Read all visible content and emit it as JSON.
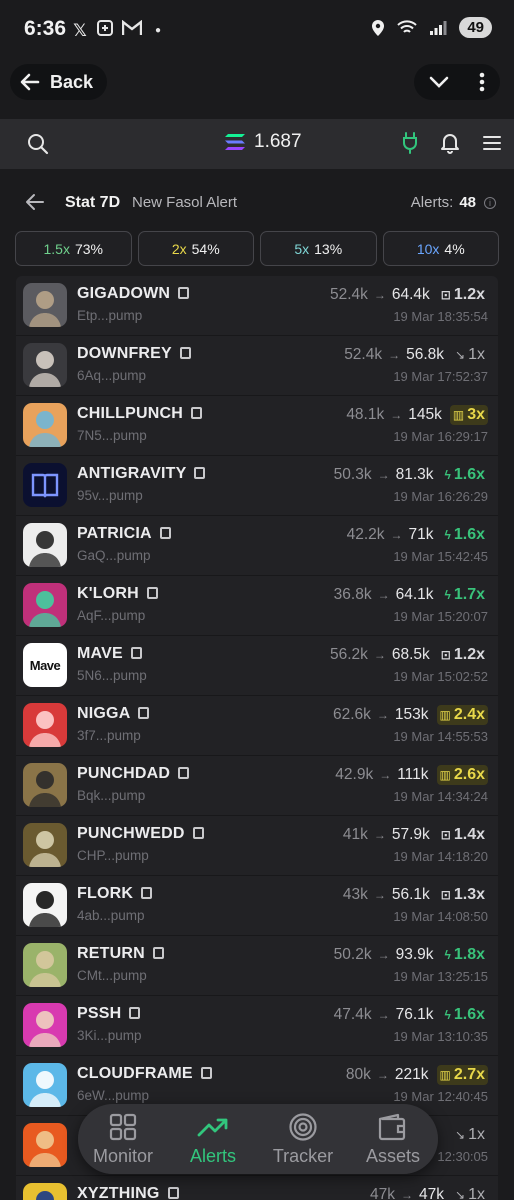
{
  "status_bar": {
    "time": "6:36",
    "left_icons": [
      "x-icon",
      "sync-icon",
      "gmail-icon",
      "dot"
    ],
    "battery": "49"
  },
  "app_bar": {
    "back_label": "Back"
  },
  "wallet": {
    "balance": "1.687",
    "colors": {
      "sol_top": "#14f195",
      "sol_mid": "#6b7cff",
      "sol_bottom": "#9945ff",
      "plug": "#32c67d"
    }
  },
  "stat": {
    "title": "Stat 7D",
    "subtitle": "New Fasol Alert",
    "alerts_label": "Alerts:",
    "alerts_count": "48"
  },
  "filters": [
    {
      "mult": "1.5x",
      "pct": "73%",
      "color": "#6fd08c"
    },
    {
      "mult": "2x",
      "pct": "54%",
      "color": "#e8d84a"
    },
    {
      "mult": "5x",
      "pct": "13%",
      "color": "#7fd6d6"
    },
    {
      "mult": "10x",
      "pct": "4%",
      "color": "#6aa6ff"
    }
  ],
  "tokens": [
    {
      "name": "GIGADOWN",
      "addr": "Etp...pump",
      "from": "52.4k",
      "to": "64.4k",
      "badge_icon": "⊡",
      "badge": "1.2x",
      "style": "plain",
      "time": "19 Mar 18:35:54",
      "av_bg": "#5b5b60",
      "av_fg": "#b8a48a",
      "av_text": ""
    },
    {
      "name": "DOWNFREY",
      "addr": "6Aq...pump",
      "from": "52.4k",
      "to": "56.8k",
      "badge_icon": "↘",
      "badge": "1x",
      "style": "gray",
      "time": "19 Mar 17:52:37",
      "av_bg": "#3a3a3e",
      "av_fg": "#d8d0c8",
      "av_text": ""
    },
    {
      "name": "CHILLPUNCH",
      "addr": "7N5...pump",
      "from": "48.1k",
      "to": "145k",
      "badge_icon": "▥",
      "badge": "3x",
      "style": "yellow",
      "time": "19 Mar 16:29:17",
      "av_bg": "#e8a25c",
      "av_fg": "#6fb6d8",
      "av_text": ""
    },
    {
      "name": "ANTIGRAVITY",
      "addr": "95v...pump",
      "from": "50.3k",
      "to": "81.3k",
      "badge_icon": "ϟ",
      "badge": "1.6x",
      "style": "green",
      "time": "19 Mar 16:26:29",
      "av_bg": "#0b1030",
      "av_fg": "#6b8cff",
      "av_text": "📖"
    },
    {
      "name": "PATRICIA",
      "addr": "GaQ...pump",
      "from": "42.2k",
      "to": "71k",
      "badge_icon": "ϟ",
      "badge": "1.6x",
      "style": "green",
      "time": "19 Mar 15:42:45",
      "av_bg": "#ededed",
      "av_fg": "#222",
      "av_text": ""
    },
    {
      "name": "K'LORH",
      "addr": "AqF...pump",
      "from": "36.8k",
      "to": "64.1k",
      "badge_icon": "ϟ",
      "badge": "1.7x",
      "style": "green",
      "time": "19 Mar 15:20:07",
      "av_bg": "#c0307a",
      "av_fg": "#3fd0a0",
      "av_text": ""
    },
    {
      "name": "MAVE",
      "addr": "5N6...pump",
      "from": "56.2k",
      "to": "68.5k",
      "badge_icon": "⊡",
      "badge": "1.2x",
      "style": "plain",
      "time": "19 Mar 15:02:52",
      "av_bg": "#ffffff",
      "av_fg": "#111",
      "av_text": "Mave"
    },
    {
      "name": "NIGGA",
      "addr": "3f7...pump",
      "from": "62.6k",
      "to": "153k",
      "badge_icon": "▥",
      "badge": "2.4x",
      "style": "yellow",
      "time": "19 Mar 14:55:53",
      "av_bg": "#d83a3a",
      "av_fg": "#ffd0d0",
      "av_text": ""
    },
    {
      "name": "PUNCHDAD",
      "addr": "Bqk...pump",
      "from": "42.9k",
      "to": "111k",
      "badge_icon": "▥",
      "badge": "2.6x",
      "style": "yellow",
      "time": "19 Mar 14:34:24",
      "av_bg": "#8a7448",
      "av_fg": "#2a2a2a",
      "av_text": ""
    },
    {
      "name": "PUNCHWEDD",
      "addr": "CHP...pump",
      "from": "41k",
      "to": "57.9k",
      "badge_icon": "⊡",
      "badge": "1.4x",
      "style": "plain",
      "time": "19 Mar 14:18:20",
      "av_bg": "#6a5a30",
      "av_fg": "#d8d0b0",
      "av_text": ""
    },
    {
      "name": "FLORK",
      "addr": "4ab...pump",
      "from": "43k",
      "to": "56.1k",
      "badge_icon": "⊡",
      "badge": "1.3x",
      "style": "plain",
      "time": "19 Mar 14:08:50",
      "av_bg": "#f4f4f4",
      "av_fg": "#111",
      "av_text": ""
    },
    {
      "name": "RETURN",
      "addr": "CMt...pump",
      "from": "50.2k",
      "to": "93.9k",
      "badge_icon": "ϟ",
      "badge": "1.8x",
      "style": "green",
      "time": "19 Mar 13:25:15",
      "av_bg": "#9ab36a",
      "av_fg": "#d8c8a0",
      "av_text": ""
    },
    {
      "name": "PSSH",
      "addr": "3Ki...pump",
      "from": "47.4k",
      "to": "76.1k",
      "badge_icon": "ϟ",
      "badge": "1.6x",
      "style": "green",
      "time": "19 Mar 13:10:35",
      "av_bg": "#d83ab0",
      "av_fg": "#f0d0c0",
      "av_text": ""
    },
    {
      "name": "CLOUDFRAME",
      "addr": "6eW...pump",
      "from": "80k",
      "to": "221k",
      "badge_icon": "▥",
      "badge": "2.7x",
      "style": "yellow",
      "time": "19 Mar 12:40:45",
      "av_bg": "#5cb8e8",
      "av_fg": "#ffffff",
      "av_text": ""
    },
    {
      "name": "",
      "addr": "",
      "from": "",
      "to": "",
      "badge_icon": "↘",
      "badge": "1x",
      "style": "gray",
      "time": "12:30:05",
      "av_bg": "#e85a20",
      "av_fg": "#f0c890",
      "av_text": ""
    },
    {
      "name": "XYZTHING",
      "addr": "",
      "from": "47k",
      "to": "47k",
      "badge_icon": "↘",
      "badge": "1x",
      "style": "gray",
      "time": "",
      "av_bg": "#e8c030",
      "av_fg": "#1a3a8a",
      "av_text": ""
    }
  ],
  "nav": [
    {
      "label": "Monitor",
      "icon": "monitor-grid-icon",
      "active": false
    },
    {
      "label": "Alerts",
      "icon": "trending-up-icon",
      "active": true
    },
    {
      "label": "Tracker",
      "icon": "target-icon",
      "active": false
    },
    {
      "label": "Assets",
      "icon": "wallet-icon",
      "active": false
    }
  ]
}
